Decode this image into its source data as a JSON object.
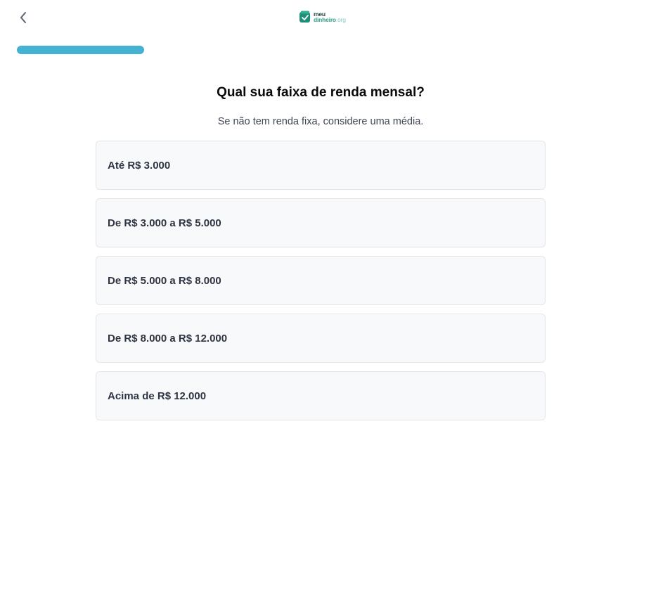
{
  "header": {
    "back_icon": "chevron-left-icon",
    "logo": {
      "line1": "meu",
      "line2": "dinheiro",
      "line2_suffix": ".org",
      "brand_color": "#2f9e88"
    }
  },
  "progress": {
    "fraction": 0.2,
    "color": "#45b2d3"
  },
  "question": {
    "title": "Qual sua faixa de renda mensal?",
    "subtitle": "Se não tem renda fixa, considere uma média."
  },
  "options": [
    {
      "label": "Até R$ 3.000"
    },
    {
      "label": "De R$ 3.000 a R$ 5.000"
    },
    {
      "label": "De R$ 5.000 a R$ 8.000"
    },
    {
      "label": "De R$ 8.000 a R$ 12.000"
    },
    {
      "label": "Acima de R$ 12.000"
    }
  ]
}
